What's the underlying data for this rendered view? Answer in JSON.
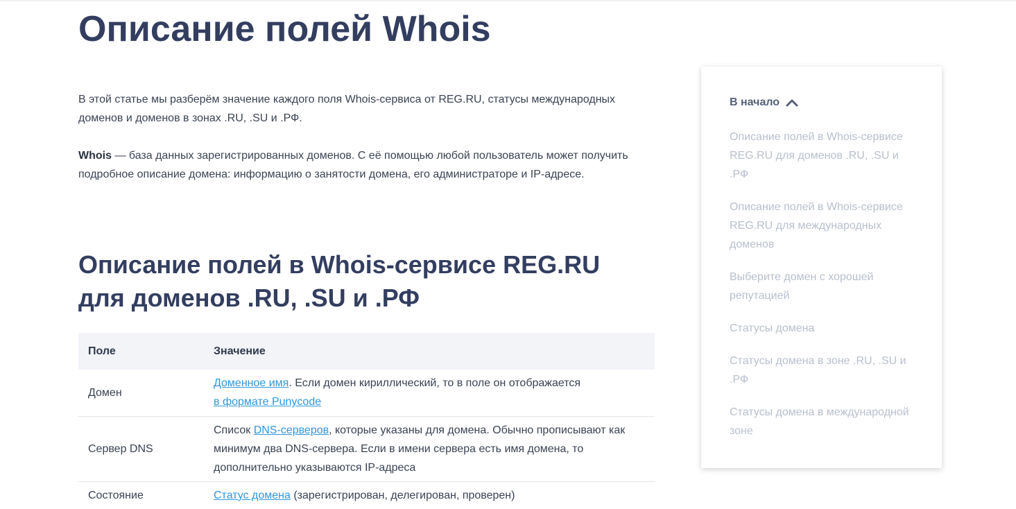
{
  "page": {
    "title": "Описание полей Whois",
    "intro": "В этой статье мы разберём значение каждого поля Whois-сервиса от REG.RU, статусы международных доменов и доменов в зонах .RU, .SU и .РФ.",
    "whois_term": "Whois",
    "whois_def": " — база данных зарегистрированных доменов. С её помощью любой пользователь может получить подробное описание домена: информацию о занятости домена, его администраторе и IP-адресе."
  },
  "section": {
    "title": "Описание полей в Whois-сервисе REG.RU для доменов .RU, .SU и .РФ"
  },
  "table": {
    "headers": [
      "Поле",
      "Значение"
    ],
    "rows": [
      {
        "field": "Домен",
        "link1": "Доменное имя",
        "text1": ". Если домен кириллический, то в поле он отображается ",
        "link2": "в формате Punycode"
      },
      {
        "field": "Сервер DNS",
        "pre": "Список ",
        "link1": "DNS-серверов",
        "text1": ", которые указаны для домена. Обычно прописывают как минимум два DNS-сервера. Если в имени сервера есть имя домена, то дополнительно указываются IP-адреса"
      },
      {
        "field": "Состояние",
        "link1": "Статус домена",
        "text1": " (зарегистрирован, делегирован, проверен)"
      }
    ]
  },
  "toc": {
    "head": "В начало",
    "head_icon": "chevron-up-icon",
    "items": [
      "Описание полей в Whois-сервисе REG.RU для доменов .RU, .SU и .РФ",
      "Описание полей в Whois-сервисе REG.RU для международных доменов",
      "Выберите домен с хорошей репутацией",
      "Статусы домена",
      "Статусы домена в зоне .RU, .SU и .РФ",
      "Статусы домена в международной зоне"
    ]
  },
  "colors": {
    "heading": "#333e5f",
    "link": "#2f96dc",
    "toc_item": "#b8bfcc",
    "table_header_bg": "#f2f4f8"
  }
}
